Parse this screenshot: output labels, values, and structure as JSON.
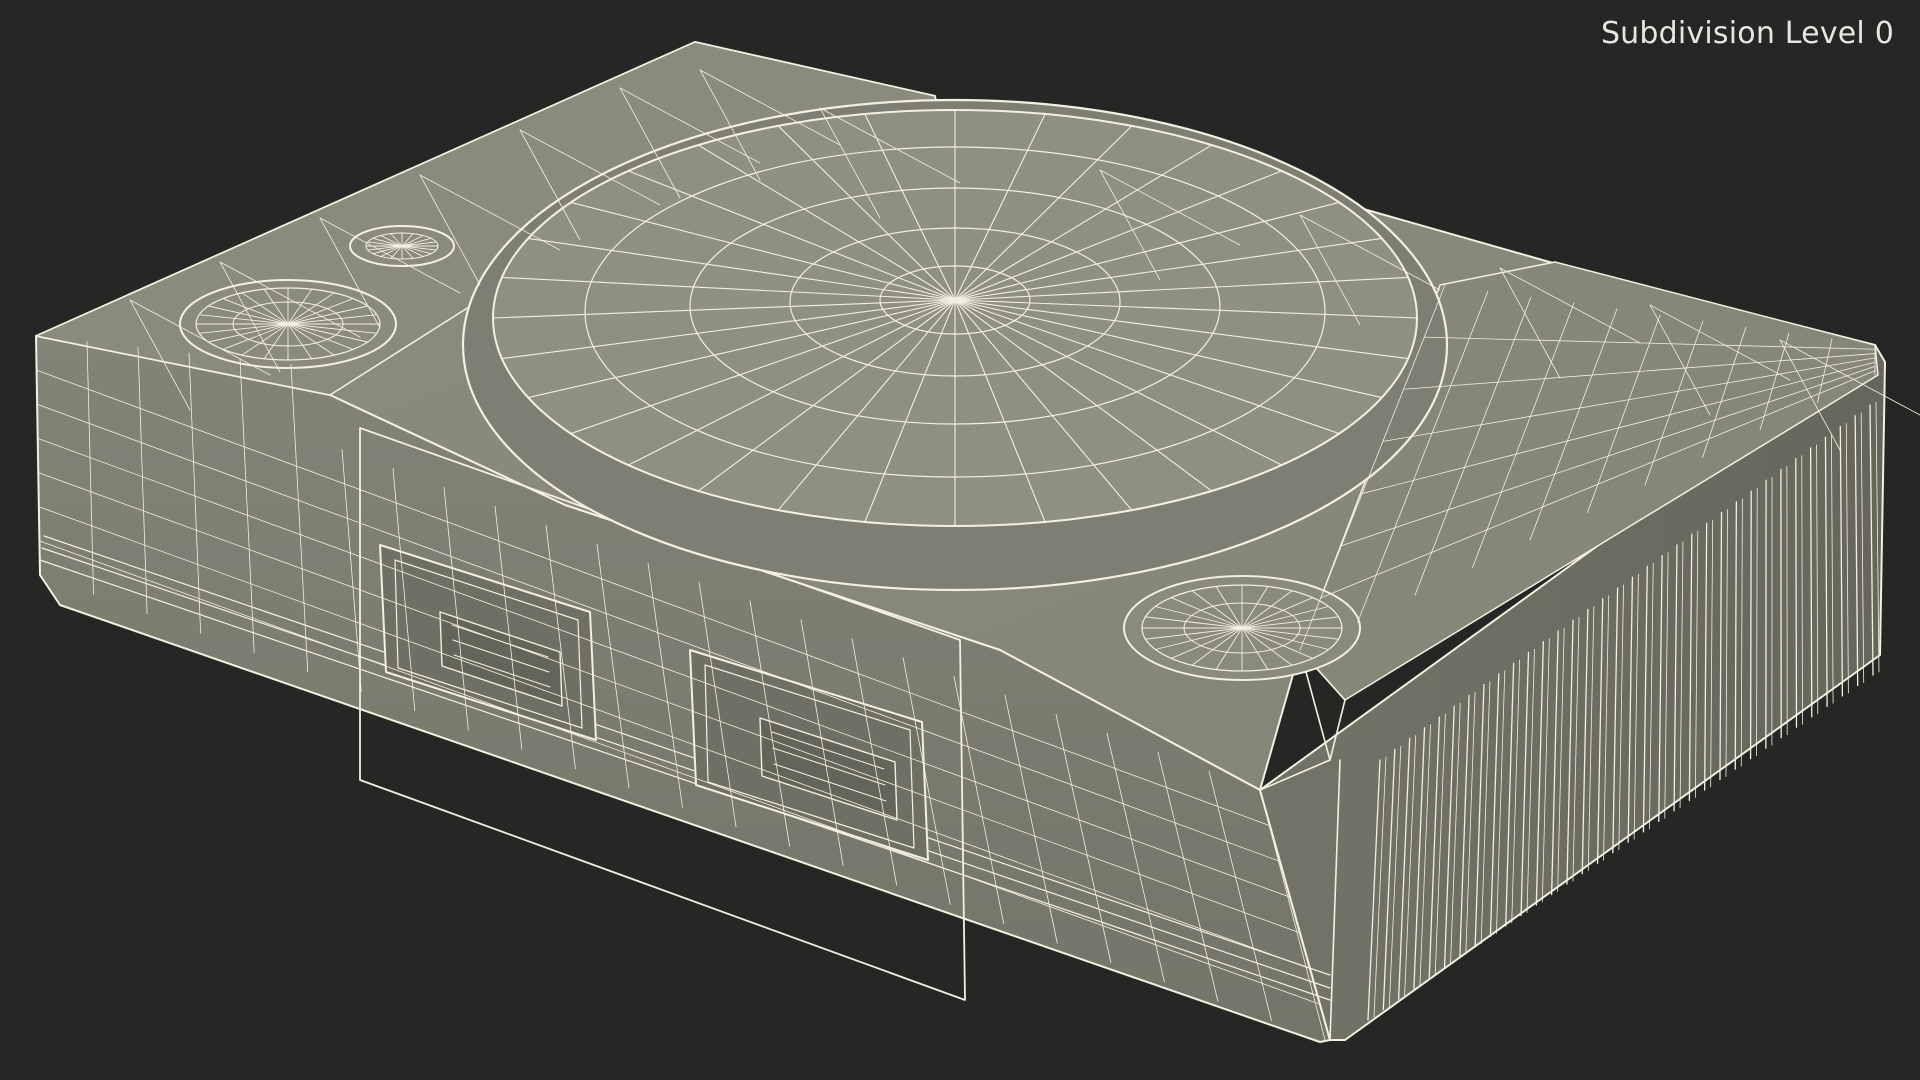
{
  "render_label": "Subdivision Level 0",
  "colors": {
    "background": "#262625",
    "surface_top": "#8a8a7c",
    "surface_front": "#7d7d70",
    "surface_side": "#6f6f63",
    "surface_disc": "#85857a",
    "wire": "#f2f0e0",
    "label": "#e6e6e2"
  }
}
